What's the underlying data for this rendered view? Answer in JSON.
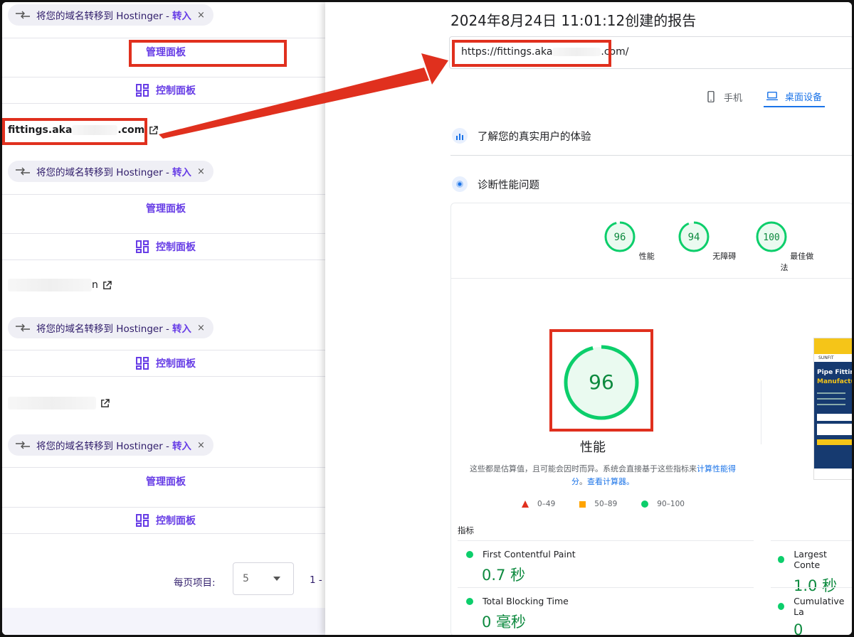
{
  "left": {
    "transfer_text": "将您的域名转移到 Hostinger -",
    "transfer_link": "转入",
    "close": "×",
    "manage_panel": "管理面板",
    "control_panel": "控制面板",
    "domain1": "fittings.aka",
    "domain1_tail": ".com",
    "domain2_tail": "n",
    "pager_label": "每页项目:",
    "pager_value": "5",
    "pager_range": "1 -"
  },
  "right": {
    "title": "2024年8月24日 11:01:12创建的报告",
    "url_head": "https://fittings.aka",
    "url_tail": ".com/",
    "tab_mobile": "手机",
    "tab_desktop": "桌面设备",
    "section_real_users": "了解您的真实用户的体验",
    "section_diagnose": "诊断性能问题",
    "scores": [
      {
        "value": "96",
        "label": "性能"
      },
      {
        "value": "94",
        "label": "无障碍"
      },
      {
        "value": "100",
        "label": "最佳做法"
      }
    ],
    "big_score": "96",
    "big_label": "性能",
    "desc_text": "这些都是估算值，且可能会因时而异。系统会直接基于这些指标来",
    "desc_link1": "计算性能得分",
    "desc_mid": "。",
    "desc_link2": "查看计算器。",
    "legend": [
      "0–49",
      "50–89",
      "90–100"
    ],
    "metrics_title": "指标",
    "metrics": [
      {
        "name": "First Contentful Paint",
        "value": "0.7 秒"
      },
      {
        "name": "Largest Conte",
        "value": "1.0 秒"
      },
      {
        "name": "Total Blocking Time",
        "value": "0 毫秒"
      },
      {
        "name": "Cumulative La",
        "value": "0"
      }
    ],
    "thumb_brand": "SUNFIT",
    "thumb_title": "Pipe Fittin",
    "thumb_sub": "Manufactu"
  },
  "colors": {
    "hostinger_purple": "#673de6",
    "highlight_red": "#e0301e",
    "pass_green": "#0cce6b",
    "score_text_green": "#0d8a3f",
    "accent_blue": "#1a73e8"
  }
}
